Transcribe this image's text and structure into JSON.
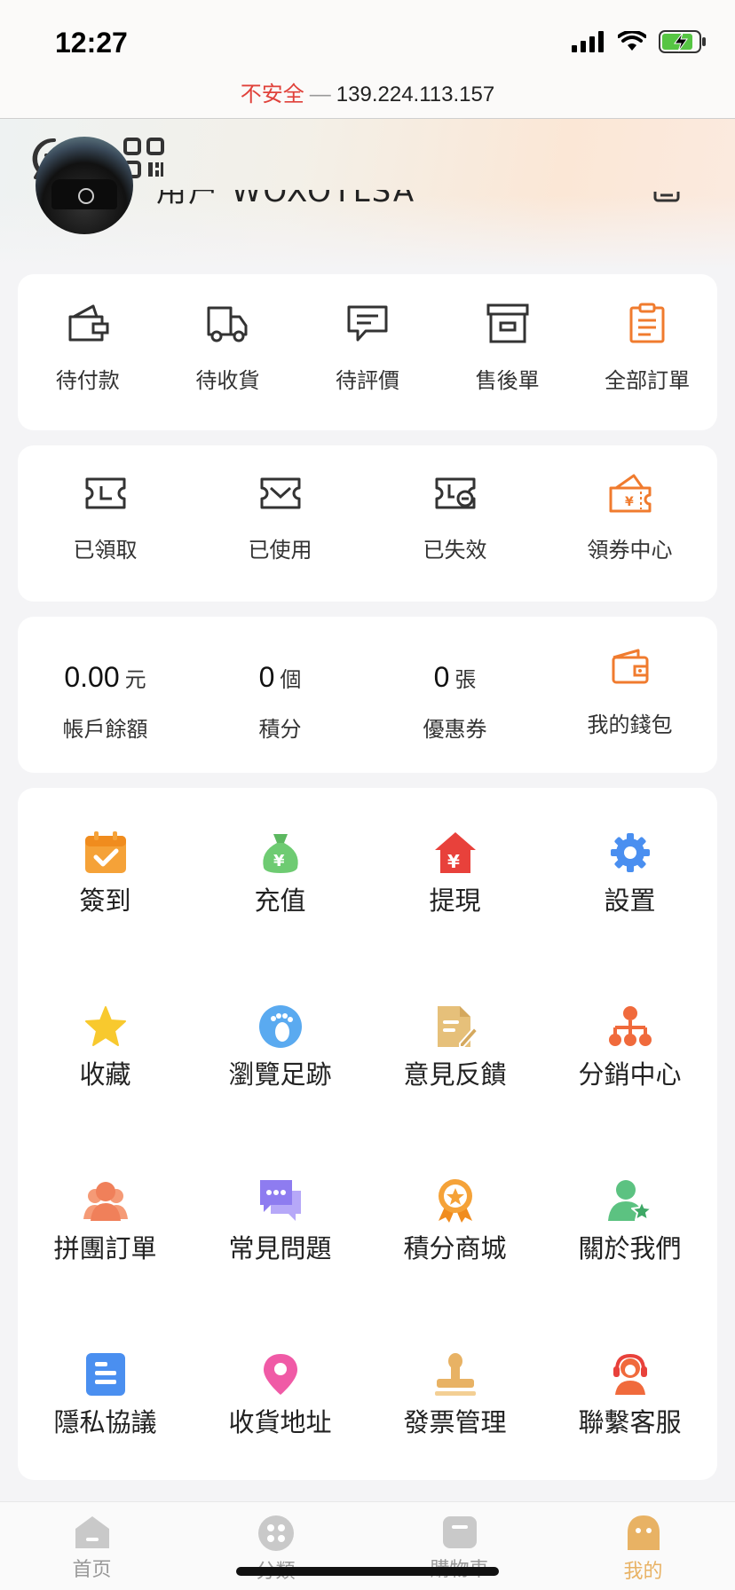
{
  "status": {
    "time": "12:27",
    "url_insecure": "不安全",
    "url_dash": "—",
    "url_host": "139.224.113.157"
  },
  "header": {
    "username_partial": "用户 WOXOTLSA"
  },
  "orders": [
    {
      "label": "待付款",
      "icon": "wallet-icon"
    },
    {
      "label": "待收貨",
      "icon": "truck-icon"
    },
    {
      "label": "待評價",
      "icon": "comment-icon"
    },
    {
      "label": "售後單",
      "icon": "archive-box-icon"
    },
    {
      "label": "全部訂單",
      "icon": "clipboard-icon"
    }
  ],
  "coupons": [
    {
      "label": "已領取",
      "icon": "ticket-received-icon"
    },
    {
      "label": "已使用",
      "icon": "ticket-used-icon"
    },
    {
      "label": "已失效",
      "icon": "ticket-expired-icon"
    },
    {
      "label": "領券中心",
      "icon": "coupon-center-icon"
    }
  ],
  "stats": [
    {
      "value": "0.00",
      "unit": "元",
      "label": "帳戶餘額"
    },
    {
      "value": "0",
      "unit": "個",
      "label": "積分"
    },
    {
      "value": "0",
      "unit": "張",
      "label": "優惠券"
    }
  ],
  "wallet": {
    "label": "我的錢包",
    "icon": "wallet-card-icon"
  },
  "services": [
    {
      "label": "簽到",
      "icon": "calendar-check-icon",
      "color": "#f5a238"
    },
    {
      "label": "充值",
      "icon": "money-bag-icon",
      "color": "#6ecb72"
    },
    {
      "label": "提現",
      "icon": "withdraw-house-icon",
      "color": "#e8413b"
    },
    {
      "label": "設置",
      "icon": "gear-icon",
      "color": "#4a8ff0"
    },
    {
      "label": "收藏",
      "icon": "star-icon",
      "color": "#f8c92e"
    },
    {
      "label": "瀏覽足跡",
      "icon": "footprint-icon",
      "color": "#5aaaf0"
    },
    {
      "label": "意見反饋",
      "icon": "feedback-doc-icon",
      "color": "#e6c07a"
    },
    {
      "label": "分銷中心",
      "icon": "org-chart-icon",
      "color": "#f06a3c"
    },
    {
      "label": "拼團訂單",
      "icon": "group-users-icon",
      "color": "#f0805a"
    },
    {
      "label": "常見問題",
      "icon": "chat-bubbles-icon",
      "color": "#8e7cf0"
    },
    {
      "label": "積分商城",
      "icon": "medal-icon",
      "color": "#f5a238"
    },
    {
      "label": "關於我們",
      "icon": "user-star-icon",
      "color": "#5cc281"
    },
    {
      "label": "隱私協議",
      "icon": "document-icon",
      "color": "#4a8ff0"
    },
    {
      "label": "收貨地址",
      "icon": "location-pin-icon",
      "color": "#f05aa6"
    },
    {
      "label": "發票管理",
      "icon": "stamp-icon",
      "color": "#e8b264"
    },
    {
      "label": "聯繫客服",
      "icon": "headset-agent-icon",
      "color": "#f06a3c"
    }
  ],
  "nav": [
    {
      "label": "首页",
      "icon": "home-icon"
    },
    {
      "label": "分類",
      "icon": "category-icon"
    },
    {
      "label": "購物車",
      "icon": "cart-icon"
    },
    {
      "label": "我的",
      "icon": "profile-icon",
      "active": true
    }
  ],
  "colors": {
    "accent": "#f07b2e",
    "nav_active": "#e8b264"
  }
}
